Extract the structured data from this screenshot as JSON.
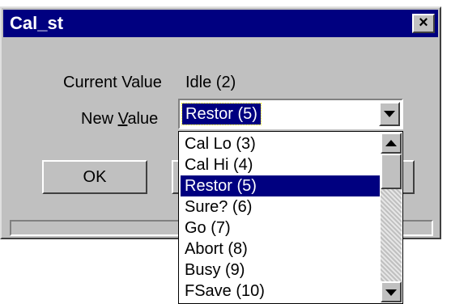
{
  "window": {
    "title": "Cal_st",
    "close_glyph": "×"
  },
  "fields": {
    "current_value_label": "Current Value",
    "current_value": "Idle (2)",
    "new_value_label_pre": "New ",
    "new_value_label_accel": "V",
    "new_value_label_post": "alue",
    "new_value_selected": "Restor (5)"
  },
  "buttons": {
    "ok": "OK"
  },
  "dropdown": {
    "items": [
      {
        "label": "Cal Lo (3)",
        "selected": false
      },
      {
        "label": "Cal Hi (4)",
        "selected": false
      },
      {
        "label": "Restor (5)",
        "selected": true
      },
      {
        "label": "Sure? (6)",
        "selected": false
      },
      {
        "label": "Go (7)",
        "selected": false
      },
      {
        "label": "Abort (8)",
        "selected": false
      },
      {
        "label": "Busy (9)",
        "selected": false
      },
      {
        "label": "FSave (10)",
        "selected": false
      }
    ]
  },
  "icons": {
    "close": "close-icon",
    "combo_arrow": "chevron-down-icon",
    "scroll_up": "scroll-up-arrow-icon",
    "scroll_down": "scroll-down-arrow-icon"
  },
  "colors": {
    "titlebar": "#000080",
    "face": "#c0c0c0",
    "selection": "#000080"
  }
}
